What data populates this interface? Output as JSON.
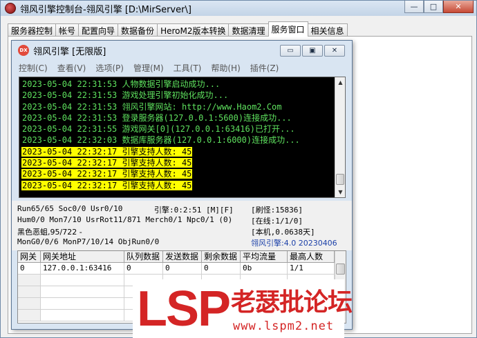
{
  "outer": {
    "title": "翎风引擎控制台-翎风引擎 [D:\\MirServer\\]",
    "win_buttons": [
      "—",
      "□",
      "✕"
    ]
  },
  "tabs": [
    "服务器控制",
    "帐号",
    "配置向导",
    "数据备份",
    "HeroM2版本转换",
    "数据清理",
    "服务窗口",
    "相关信息"
  ],
  "active_tab": 6,
  "inner": {
    "icon_text": "DX",
    "title": "翎风引擎 [无限版]",
    "buttons": [
      "▭",
      "▣",
      "✕"
    ],
    "menu": [
      "控制(C)",
      "查看(V)",
      "选项(P)",
      "管理(M)",
      "工具(T)",
      "帮助(H)",
      "插件(Z)"
    ]
  },
  "log": [
    {
      "text": "2023-05-04 22:31:53 人物数据引擎启动成功...",
      "highlight": false
    },
    {
      "text": "2023-05-04 22:31:53 游戏处理引擎初始化成功...",
      "highlight": false
    },
    {
      "text": "2023-05-04 22:31:53 翎风引擎网站: http://www.Haom2.Com",
      "highlight": false
    },
    {
      "text": "2023-05-04 22:31:53 登录服务器(127.0.0.1:5600)连接成功...",
      "highlight": false
    },
    {
      "text": "2023-05-04 22:31:55 游戏网关[0](127.0.0.1:63416)已打开...",
      "highlight": false
    },
    {
      "text": "2023-05-04 22:32:03 数据库服务器(127.0.0.1:6000)连接成功...",
      "highlight": false
    },
    {
      "text": "2023-05-04 22:32:17 引擎支持人数: 45",
      "highlight": true
    },
    {
      "text": "2023-05-04 22:32:17 引擎支持人数: 45",
      "highlight": true
    },
    {
      "text": "2023-05-04 22:32:17 引擎支持人数: 45",
      "highlight": true
    },
    {
      "text": "2023-05-04 22:32:17 引擎支持人数: 45",
      "highlight": true
    }
  ],
  "status": {
    "run": "Run65/65 Soc0/0 Usr0/10",
    "engine_time": "引擎:0:2:51 [M][F]",
    "refresh": "[刷怪:15836]",
    "hum": "Hum0/0 Mon7/10 UsrRot11/871 Merch0/1 Npc0/1 (0)",
    "online": "[在线:1/1/0]",
    "monster": "黑色恶蛆,95/722 -",
    "local": "[本机,0.0638天]",
    "mon_stats": "MonG0/0/6 MonP7/10/14 ObjRun0/0",
    "version": "翎风引擎:4.0 20230406"
  },
  "grid": {
    "headers": [
      "网关",
      "网关地址",
      "队列数据",
      "发送数据",
      "剩余数据",
      "平均流量",
      "最高人数"
    ],
    "rows": [
      [
        "0",
        "127.0.0.1:63416",
        "0",
        "0",
        "0",
        "0b",
        "1/1"
      ]
    ],
    "empty_rows": 4
  },
  "watermark": {
    "brand": "LSP",
    "cn": "老瑟批论坛",
    "url": "www.lspm2.net"
  }
}
